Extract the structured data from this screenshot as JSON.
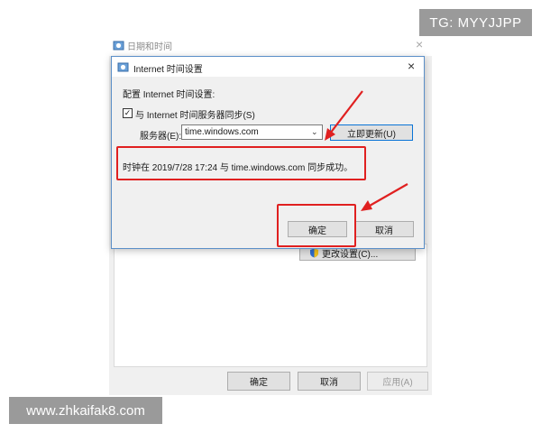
{
  "watermark": {
    "top": "TG: MYYJJPP",
    "bottom": "www.zhkaifak8.com"
  },
  "parent_window": {
    "title": "日期和时间",
    "close": "×",
    "change_settings": "更改设置(C)...",
    "ok": "确定",
    "cancel": "取消",
    "apply": "应用(A)"
  },
  "dialog": {
    "title": "Internet 时间设置",
    "close": "×",
    "section_label": "配置 Internet 时间设置:",
    "sync_checkbox": {
      "checked": true,
      "mark": "✓",
      "label": "与 Internet 时间服务器同步(S)"
    },
    "server_label": "服务器(E):",
    "server_value": "time.windows.com",
    "dropdown_arrow": "⌄",
    "update_now": "立即更新(U)",
    "status": "时钟在 2019/7/28 17:24 与 time.windows.com 同步成功。",
    "ok": "确定",
    "cancel": "取消"
  },
  "colors": {
    "annotation_red": "#e02020",
    "dialog_border": "#5b8fc8",
    "watermark_bg": "#9a9a9a"
  }
}
